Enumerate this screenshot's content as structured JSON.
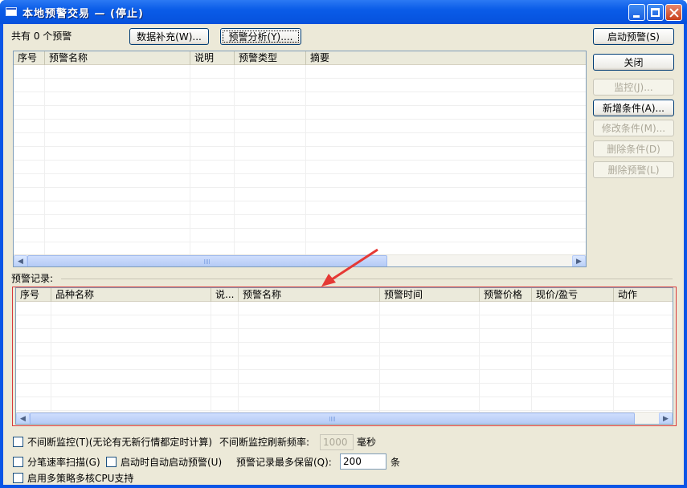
{
  "window": {
    "title": "本地预警交易 — (停止)",
    "controls": [
      "minimize",
      "maximize",
      "close"
    ]
  },
  "top": {
    "count_label": "共有 0 个预警",
    "supplement_button": "数据补充(W)...",
    "analysis_button": "预警分析(Y)...."
  },
  "right_buttons": {
    "start": "启动预警(S)",
    "close": "关闭",
    "monitor": "监控(J)...",
    "add_condition": "新增条件(A)...",
    "edit_condition": "修改条件(M)...",
    "delete_condition": "删除条件(D)",
    "delete_alert": "删除预警(L)"
  },
  "alerts_table": {
    "columns": [
      "序号",
      "预警名称",
      "说明",
      "预警类型",
      "摘要"
    ],
    "rows": []
  },
  "records": {
    "label": "预警记录:",
    "columns": [
      "序号",
      "品种名称",
      "说...",
      "预警名称",
      "预警时间",
      "预警价格",
      "现价/盈亏",
      "动作"
    ],
    "rows": []
  },
  "options": {
    "continuous_monitor_label": "不间断监控(T)(无论有无新行情都定时计算)",
    "refresh_rate_label": "不间断监控刷新频率:",
    "refresh_rate_value": "1000",
    "refresh_rate_unit": "毫秒",
    "tick_scan_label": "分笔速率扫描(G)",
    "auto_start_label": "启动时自动启动预警(U)",
    "max_records_label": "预警记录最多保留(Q):",
    "max_records_value": "200",
    "max_records_unit": "条",
    "multicore_label": "启用多策略多核CPU支持"
  },
  "scroll_icons": {
    "left": "◀",
    "right": "▶"
  },
  "colors": {
    "titlebar": "#0a5ce8",
    "window_bg": "#ece9d8",
    "annotation_red": "#d9393b"
  }
}
